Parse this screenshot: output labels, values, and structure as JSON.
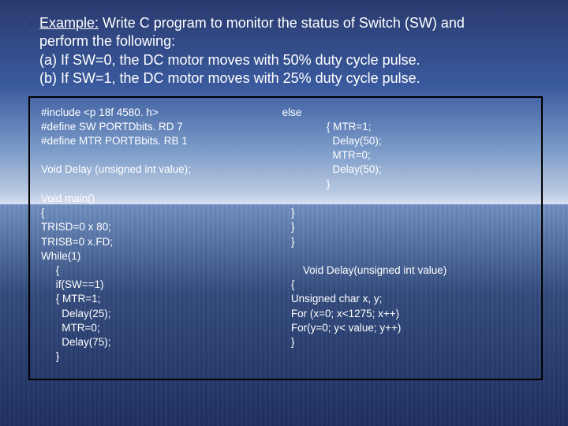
{
  "title": {
    "line1_prefix": "Example:",
    "line1_rest": " Write C program to monitor the status of Switch (SW) and",
    "line2": "perform the following:",
    "line3": "(a) If SW=0, the DC motor moves with 50% duty cycle pulse.",
    "line4": "(b) If SW=1, the DC motor moves with 25% duty cycle pulse."
  },
  "code_left": "#include <p 18f 4580. h>\n#define SW PORTDbits. RD 7\n#define MTR PORTBbits. RB 1\n\nVoid Delay (unsigned int value);\n\nVoid main()\n{\nTRISD=0 x 80;\nTRISB=0 x.FD;\nWhile(1)\n     {\n     if(SW==1)\n     { MTR=1;\n       Delay(25);\n       MTR=0;\n       Delay(75);\n     }",
  "code_right": "else\n               { MTR=1;\n                 Delay(50);\n                 MTR=0;\n                 Delay(50);\n               }\n\n   }\n   }\n   }\n\n       Void Delay(unsigned int value)\n   {\n   Unsigned char x, y;\n   For (x=0; x<1275; x++)\n   For(y=0; y< value; y++)\n   }"
}
